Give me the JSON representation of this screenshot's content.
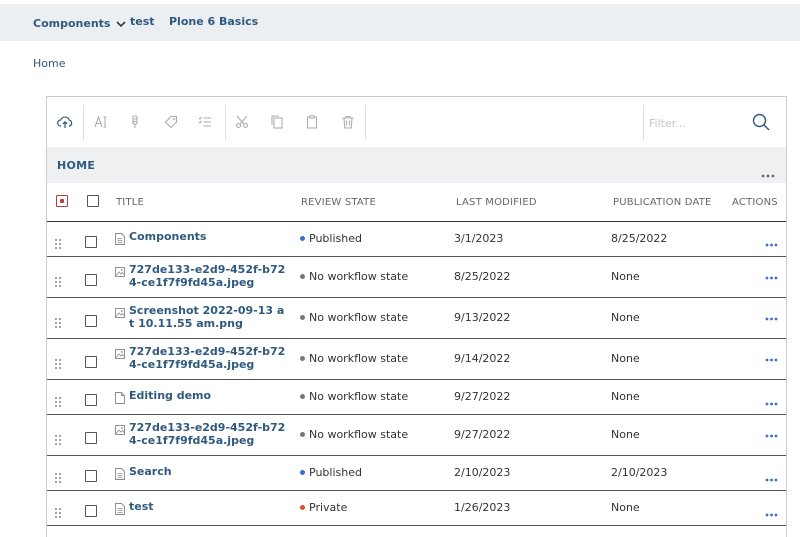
{
  "topnav": {
    "items": [
      {
        "label": "Components",
        "has_dropdown": true,
        "icon": "chevron-down-icon"
      },
      {
        "label": "test"
      },
      {
        "label": "Plone 6 Basics"
      }
    ]
  },
  "breadcrumb": {
    "home": "Home"
  },
  "toolbar": {
    "icons": [
      "upload-icon",
      "rename-icon",
      "state-icon",
      "tags-icon",
      "properties-icon",
      "cut-icon",
      "copy-icon",
      "paste-icon",
      "delete-icon"
    ],
    "filter_placeholder": "Filter...",
    "search_icon": "search-icon"
  },
  "folder": {
    "title": "HOME",
    "more_icon": "ellipsis-icon"
  },
  "table": {
    "columns": {
      "title": "TITLE",
      "review_state": "REVIEW STATE",
      "last_modified": "LAST MODIFIED",
      "publication_date": "PUBLICATION DATE",
      "actions": "ACTIONS"
    },
    "rows": [
      {
        "title": "Components",
        "type": "page-icon",
        "state": "Published",
        "modified": "3/1/2023",
        "published": "8/25/2022"
      },
      {
        "title": "727de133-e2d9-452f-b724-ce1f7f9fd45a.jpeg",
        "type": "image-icon",
        "state": "No workflow state",
        "modified": "8/25/2022",
        "published": "None"
      },
      {
        "title": "Screenshot 2022-09-13 at 10.11.55 am.png",
        "type": "image-icon",
        "state": "No workflow state",
        "modified": "9/13/2022",
        "published": "None"
      },
      {
        "title": "727de133-e2d9-452f-b724-ce1f7f9fd45a.jpeg",
        "type": "image-icon",
        "state": "No workflow state",
        "modified": "9/14/2022",
        "published": "None"
      },
      {
        "title": "Editing demo",
        "type": "file-icon",
        "state": "No workflow state",
        "modified": "9/27/2022",
        "published": "None"
      },
      {
        "title": "727de133-e2d9-452f-b724-ce1f7f9fd45a.jpeg",
        "type": "image-icon",
        "state": "No workflow state",
        "modified": "9/27/2022",
        "published": "None"
      },
      {
        "title": "Search",
        "type": "page-icon",
        "state": "Published",
        "modified": "2/10/2023",
        "published": "2/10/2023"
      },
      {
        "title": "test",
        "type": "page-icon",
        "state": "Private",
        "modified": "1/26/2023",
        "published": "None"
      }
    ]
  },
  "colors": {
    "link": "#2f5a7e",
    "published": "#3b70c4",
    "no_workflow": "#777777",
    "private": "#d3532e",
    "header_bg": "#eef0f1",
    "nav_bg": "#eceff1"
  }
}
